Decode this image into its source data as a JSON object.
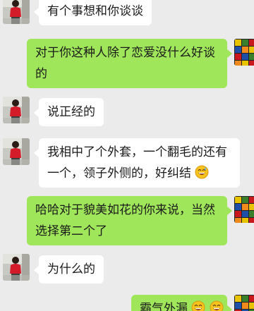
{
  "messages": [
    {
      "side": "left",
      "lines": [
        "有个事想和你谈谈"
      ]
    },
    {
      "side": "right",
      "lines": [
        "对于你这种人除了恋爱没什么好谈",
        "的"
      ]
    },
    {
      "side": "left",
      "lines": [
        "说正经的"
      ]
    },
    {
      "side": "left",
      "lines": [
        "我相中了个外套，一个翻毛的还有",
        "一个，领子外侧的，好纠结"
      ],
      "emoji": "grin-sweat-emoji"
    },
    {
      "side": "right",
      "lines": [
        "哈哈对于貌美如花的你来说，当然",
        "选择第二个了"
      ]
    },
    {
      "side": "left",
      "lines": [
        "为什么的"
      ]
    },
    {
      "side": "right",
      "lines": [
        "霸气外漏"
      ],
      "emoji": "laugh-emoji"
    }
  ],
  "colors": {
    "background": "#ebebeb",
    "bubble_left": "#ffffff",
    "bubble_right": "#9fe65b"
  }
}
